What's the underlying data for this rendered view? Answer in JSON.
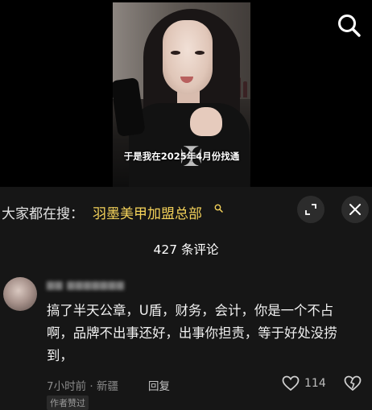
{
  "video": {
    "subtitle": "于是我在2025年4月份找通"
  },
  "search_bar": {
    "prefix": "大家都在搜：",
    "term": "羽墨美甲加盟总部"
  },
  "comments": {
    "count_label": "427 条评论",
    "items": [
      {
        "username": "",
        "text": "搞了半天公章，U盾，财务，会计，你是一个不占啊，品牌不出事还好，出事你担责，等于好处没捞到，",
        "time_location": "7小时前 · 新疆",
        "reply_label": "回复",
        "like_count": "114",
        "badge": "作者赞过"
      }
    ]
  },
  "icons": [
    "search-icon",
    "search-suggestion-icon",
    "expand-icon",
    "close-icon",
    "heart-icon",
    "broken-heart-icon"
  ],
  "colors": {
    "background": "#161616",
    "search_highlight": "#f4d25a"
  }
}
